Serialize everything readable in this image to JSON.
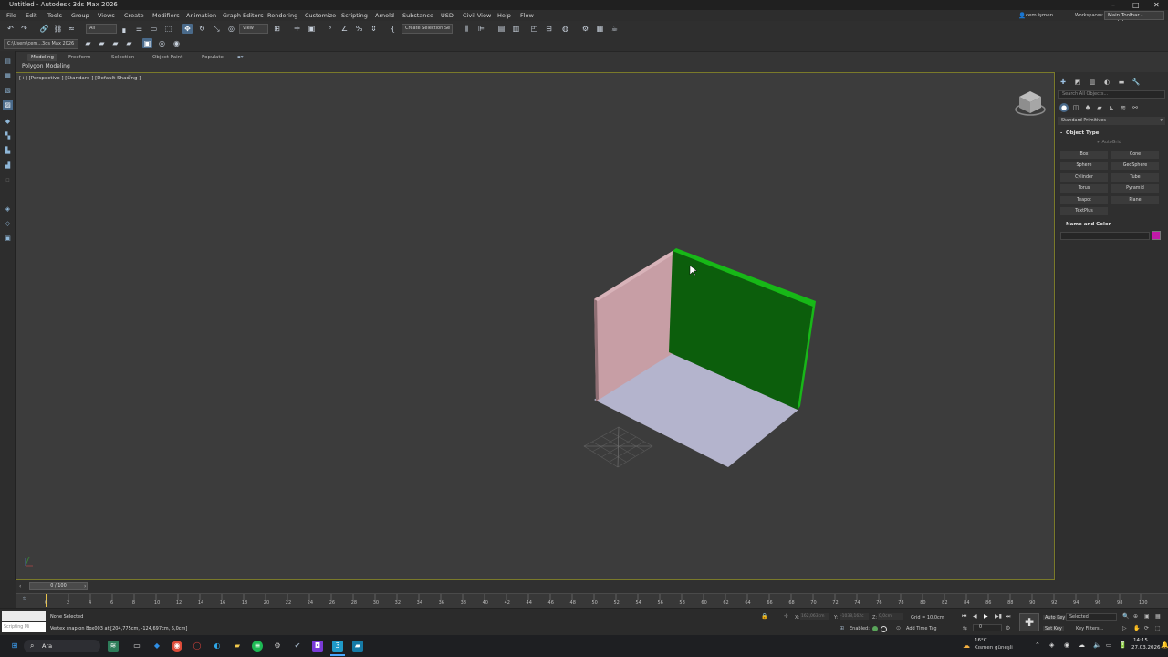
{
  "app": {
    "window_title": "Untitled - Autodesk 3ds Max 2026",
    "window_controls": [
      "–",
      "□",
      "✕"
    ]
  },
  "menu": {
    "items": [
      "File",
      "Edit",
      "Tools",
      "Group",
      "Views",
      "Create",
      "Modifiers",
      "Animation",
      "Graph Editors",
      "Rendering",
      "Customize",
      "Scripting",
      "Arnold",
      "Substance",
      "USD",
      "Civil View",
      "Help",
      "Flow"
    ],
    "user": "cem işmen",
    "workspaces_label": "Workspaces:",
    "workspace_value": "Main Toolbar - modular"
  },
  "toolbar": {
    "selection_filter": "All",
    "ref_coord": "View",
    "create_selection_set": "Create Selection Se",
    "project_path": "C:\\Users\\cem...3ds Max 2026"
  },
  "ribbon": {
    "tabs": [
      "Modeling",
      "Freeform",
      "Selection",
      "Object Paint",
      "Populate"
    ],
    "sub_label": "Polygon Modeling"
  },
  "viewport": {
    "label": "[+] [Perspective ] [Standard ] [Default Shading ]",
    "filter_icon": "funnel-icon",
    "colors": {
      "left_wall": "#c79ea5",
      "back_wall": "#0c5e0c",
      "back_wall_edge": "#17b817",
      "floor": "#b4b4cd",
      "background": "#3c3c3c"
    }
  },
  "command_panel": {
    "search_placeholder": "Search All Objects...",
    "category": "Standard Primitives",
    "rollout_object_type": "Object Type",
    "autogrid": "AutoGrid",
    "buttons": [
      "Box",
      "Cone",
      "Sphere",
      "GeoSphere",
      "Cylinder",
      "Tube",
      "Torus",
      "Pyramid",
      "Teapot",
      "Plane",
      "TextPlus"
    ],
    "rollout_name_color": "Name and Color",
    "swatch_color": "#c219a8"
  },
  "timeline": {
    "frame_display": "0 / 100",
    "ticks": [
      "0",
      "2",
      "4",
      "6",
      "8",
      "10",
      "12",
      "14",
      "16",
      "18",
      "20",
      "22",
      "24",
      "26",
      "28",
      "30",
      "32",
      "34",
      "36",
      "38",
      "40",
      "42",
      "44",
      "46",
      "48",
      "50",
      "52",
      "54",
      "56",
      "58",
      "60",
      "62",
      "64",
      "66",
      "68",
      "70",
      "72",
      "74",
      "76",
      "78",
      "80",
      "82",
      "84",
      "86",
      "88",
      "90",
      "92",
      "94",
      "96",
      "98",
      "100"
    ]
  },
  "status": {
    "maxscript_label": "Scripting Mi",
    "selection": "None Selected",
    "prompt": "Vertex snap on Box003 at [204,775cm, -124,697cm, 5,0cm]",
    "x_label": "X:",
    "x_value": "162,063cm",
    "y_label": "Y:",
    "y_value": "-1038,162c",
    "z_label": "Z:",
    "z_value": "0,0cm",
    "grid": "Grid = 10,0cm",
    "enabled_label": "Enabled:",
    "add_time_tag": "Add Time Tag",
    "frame_field": "0",
    "auto_key": "Auto Key",
    "set_key": "Set Key",
    "key_mode": "Selected",
    "key_filters": "Key Filters..."
  },
  "taskbar": {
    "search": "Ara",
    "weather_temp": "16°C",
    "weather_desc": "Kısmen güneşli",
    "time": "14:15",
    "date": "27.03.2026"
  }
}
